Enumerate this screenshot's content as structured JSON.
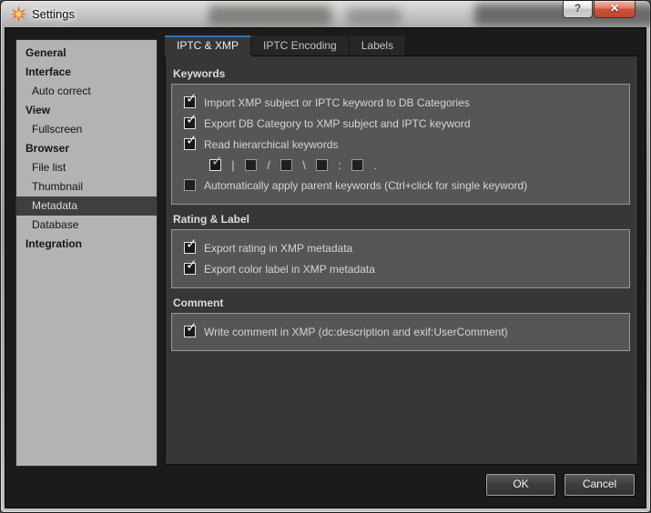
{
  "window": {
    "title": "Settings"
  },
  "titlebar": {
    "icon": "sunburst-icon",
    "help_label": "?",
    "close_label": "✕"
  },
  "sidebar": {
    "items": [
      {
        "label": "General",
        "bold": true,
        "indent": false,
        "selected": false
      },
      {
        "label": "Interface",
        "bold": true,
        "indent": false,
        "selected": false
      },
      {
        "label": "Auto correct",
        "bold": false,
        "indent": true,
        "selected": false
      },
      {
        "label": "View",
        "bold": true,
        "indent": false,
        "selected": false
      },
      {
        "label": "Fullscreen",
        "bold": false,
        "indent": true,
        "selected": false
      },
      {
        "label": "Browser",
        "bold": true,
        "indent": false,
        "selected": false
      },
      {
        "label": "File list",
        "bold": false,
        "indent": true,
        "selected": false
      },
      {
        "label": "Thumbnail",
        "bold": false,
        "indent": true,
        "selected": false
      },
      {
        "label": "Metadata",
        "bold": false,
        "indent": true,
        "selected": true
      },
      {
        "label": "Database",
        "bold": false,
        "indent": true,
        "selected": false
      },
      {
        "label": "Integration",
        "bold": true,
        "indent": false,
        "selected": false
      }
    ]
  },
  "tabs": {
    "items": [
      {
        "label": "IPTC & XMP",
        "active": true
      },
      {
        "label": "IPTC Encoding",
        "active": false
      },
      {
        "label": "Labels",
        "active": false
      }
    ]
  },
  "panel": {
    "groups": [
      {
        "title": "Keywords",
        "rows": [
          {
            "label": "Import XMP subject or IPTC keyword to DB Categories",
            "checked": true
          },
          {
            "label": "Export DB Category to XMP subject and IPTC keyword",
            "checked": true
          },
          {
            "label": "Read hierarchical keywords",
            "checked": true
          }
        ],
        "separator_row": {
          "items": [
            {
              "char": "|",
              "checked": true
            },
            {
              "char": "/",
              "checked": false
            },
            {
              "char": "\\",
              "checked": false
            },
            {
              "char": ":",
              "checked": false
            },
            {
              "char": ".",
              "checked": false
            }
          ]
        },
        "rows2": [
          {
            "label": "Automatically apply parent keywords (Ctrl+click for single keyword)",
            "checked": false
          }
        ]
      },
      {
        "title": "Rating & Label",
        "rows": [
          {
            "label": "Export rating in XMP metadata",
            "checked": true
          },
          {
            "label": "Export color label in XMP metadata",
            "checked": true
          }
        ]
      },
      {
        "title": "Comment",
        "rows": [
          {
            "label": "Write comment in XMP (dc:description and exif:UserComment)",
            "checked": true
          }
        ]
      }
    ]
  },
  "footer": {
    "ok_label": "OK",
    "cancel_label": "Cancel"
  },
  "colors": {
    "client_bg": "#1b1b1b",
    "panel_bg": "#373737",
    "groupbox_bg": "#565656",
    "sidebar_bg": "#b3b3b3",
    "selected_item_bg": "#3f3f3f",
    "active_tab_accent": "#3273bd",
    "close_button_red": "#cd5238",
    "icon_orange": "#e8641f"
  }
}
